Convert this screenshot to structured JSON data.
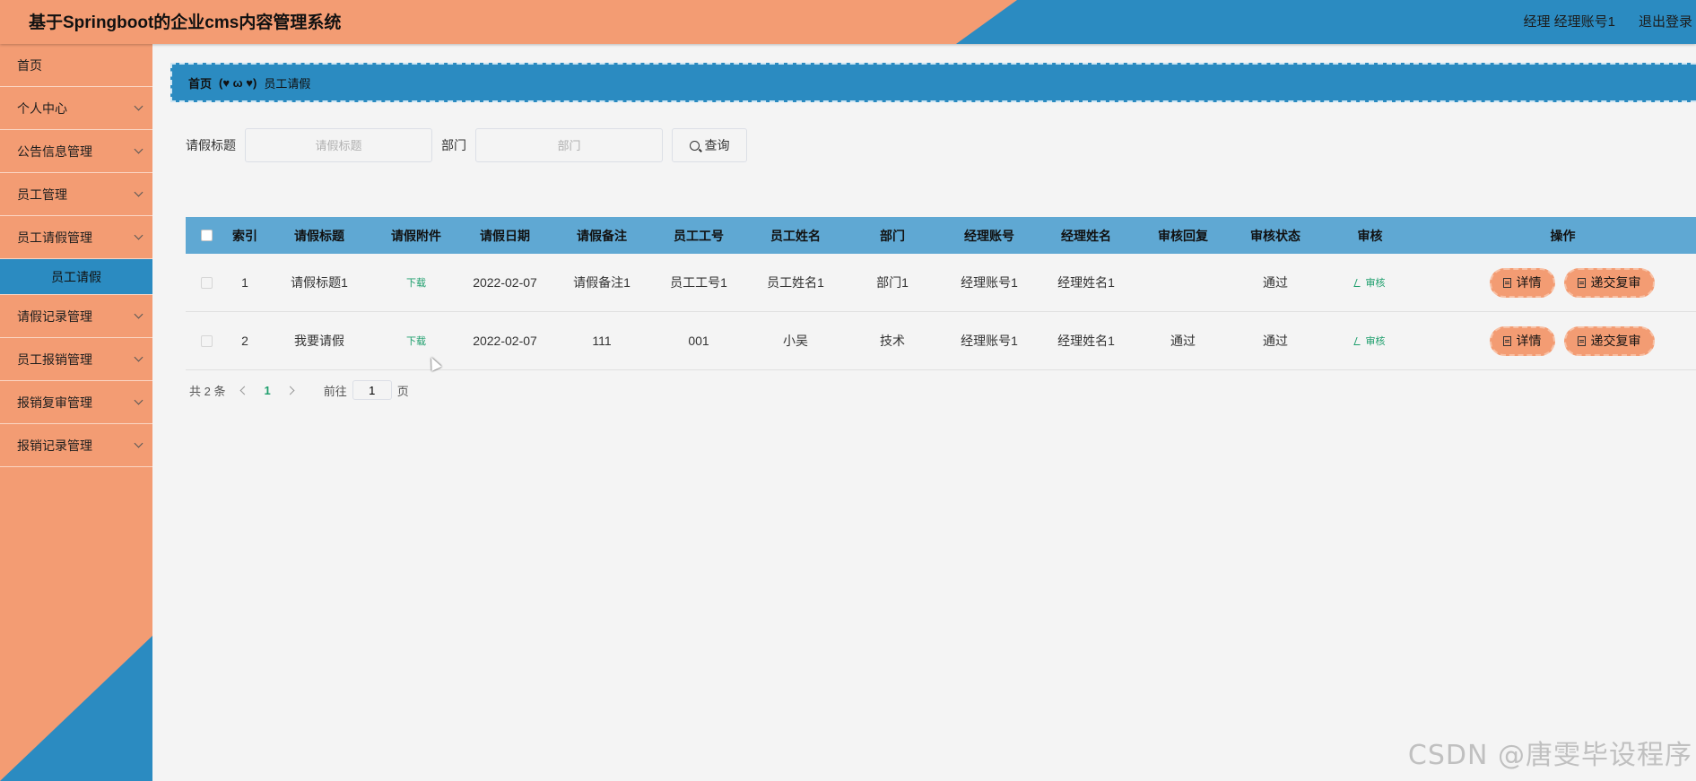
{
  "header": {
    "app_title": "基于Springboot的企业cms内容管理系统",
    "user_info": "经理 经理账号1",
    "logout_label": "退出登录"
  },
  "sidebar": {
    "items": [
      {
        "label": "首页",
        "has_chevron": false
      },
      {
        "label": "个人中心",
        "has_chevron": true
      },
      {
        "label": "公告信息管理",
        "has_chevron": true
      },
      {
        "label": "员工管理",
        "has_chevron": true
      },
      {
        "label": "员工请假管理",
        "has_chevron": true
      },
      {
        "label": "请假记录管理",
        "has_chevron": true
      },
      {
        "label": "员工报销管理",
        "has_chevron": true
      },
      {
        "label": "报销复审管理",
        "has_chevron": true
      },
      {
        "label": "报销记录管理",
        "has_chevron": true
      }
    ],
    "active_submenu": "员工请假"
  },
  "breadcrumb": {
    "home": "首页",
    "separator": "(♥ ω ♥)",
    "current": "员工请假"
  },
  "search": {
    "title_label": "请假标题",
    "title_placeholder": "请假标题",
    "dept_label": "部门",
    "dept_placeholder": "部门",
    "query_label": "查询"
  },
  "table": {
    "headers": [
      "索引",
      "请假标题",
      "请假附件",
      "请假日期",
      "请假备注",
      "员工工号",
      "员工姓名",
      "部门",
      "经理账号",
      "经理姓名",
      "审核回复",
      "审核状态",
      "审核",
      "操作"
    ],
    "rows": [
      {
        "index": "1",
        "title": "请假标题1",
        "attachment": "下载",
        "date": "2022-02-07",
        "note": "请假备注1",
        "emp_no": "员工工号1",
        "emp_name": "员工姓名1",
        "dept": "部门1",
        "mgr_account": "经理账号1",
        "mgr_name": "经理姓名1",
        "reply": "",
        "status": "通过",
        "audit": "审核",
        "detail_label": "详情",
        "resubmit_label": "递交复审"
      },
      {
        "index": "2",
        "title": "我要请假",
        "attachment": "下载",
        "date": "2022-02-07",
        "note": "111",
        "emp_no": "001",
        "emp_name": "小吴",
        "dept": "技术",
        "mgr_account": "经理账号1",
        "mgr_name": "经理姓名1",
        "reply": "通过",
        "status": "通过",
        "audit": "审核",
        "detail_label": "详情",
        "resubmit_label": "递交复审"
      }
    ]
  },
  "pagination": {
    "total": "共 2 条",
    "current_page": "1",
    "goto_label": "前往",
    "goto_value": "1",
    "page_suffix": "页"
  },
  "watermark": "CSDN @唐雯毕设程序",
  "colors": {
    "orange": "#f39c73",
    "blue": "#2b8bc1",
    "table_header": "#5fa8d3",
    "link_green": "#1d9e6c"
  }
}
